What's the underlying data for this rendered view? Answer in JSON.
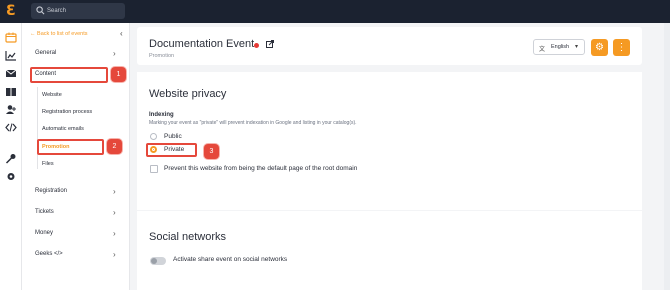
{
  "topbar": {
    "search_placeholder": "Search"
  },
  "nav": {
    "back_label": "Back to list of events",
    "items": [
      {
        "label": "General"
      },
      {
        "label": "Content"
      },
      {
        "label": "Registration"
      },
      {
        "label": "Tickets"
      },
      {
        "label": "Money"
      },
      {
        "label": "Geeks </>"
      }
    ],
    "content_sub": [
      "Website",
      "Registration process",
      "Automatic emails",
      "Promotion",
      "Files"
    ]
  },
  "header": {
    "title": "Documentation Event",
    "subtitle": "Promotion",
    "language": "English"
  },
  "privacy": {
    "title": "Website privacy",
    "indexing_label": "Indexing",
    "hint": "Marking your event as \"private\" will prevent indexation in Google and listing in your catalog(s).",
    "options": [
      "Public",
      "Private"
    ],
    "selected": "Private",
    "checkbox_label": "Prevent this website from being the default page of the root domain",
    "checkbox_checked": false
  },
  "social": {
    "title": "Social networks",
    "toggle_label": "Activate share event on social networks",
    "toggle_on": false
  },
  "annotations": [
    "1",
    "2",
    "3"
  ],
  "colors": {
    "accent": "#f59a23",
    "annotation": "#e5483b",
    "topbar": "#1b2230"
  }
}
